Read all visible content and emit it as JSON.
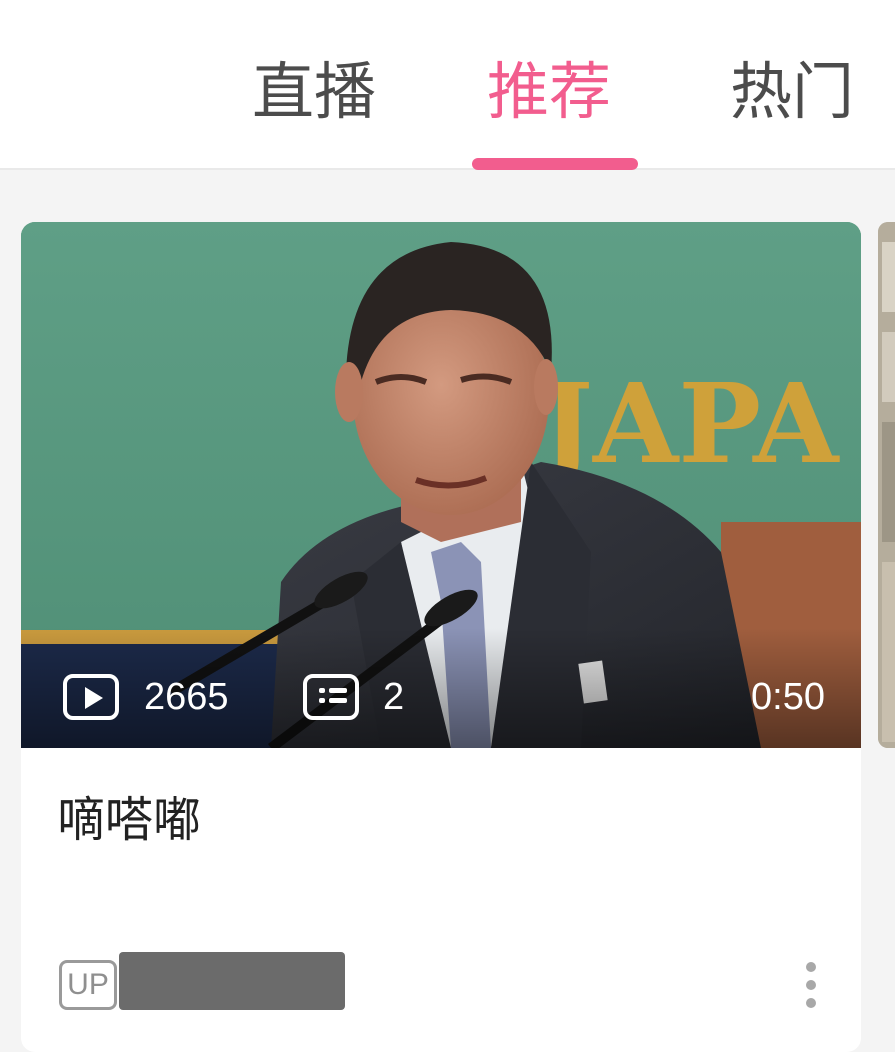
{
  "tabs": [
    {
      "label": "直播",
      "active": false
    },
    {
      "label": "推荐",
      "active": true
    },
    {
      "label": "热门",
      "active": false
    }
  ],
  "accent_color": "#f25d8e",
  "video_card": {
    "play_count": "2665",
    "comment_count": "2",
    "duration": "0:50",
    "title": "嘀嗒嘟",
    "up_badge": "UP",
    "thumbnail_text": "JAPA"
  },
  "icons": {
    "play": "play-icon",
    "comment": "comment-icon",
    "more": "more-icon"
  }
}
